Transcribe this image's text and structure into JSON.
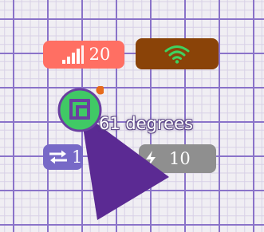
{
  "map": {
    "grid_color": "#8a73c9",
    "background_color": "#f0eef3"
  },
  "signal_badge": {
    "icon": "signal-bars-icon",
    "value": "20",
    "color": "#ff6f63"
  },
  "wifi_badge": {
    "icon": "wifi-icon",
    "color": "#8a4308",
    "icon_color": "#3fd15f"
  },
  "sync_badge": {
    "icon": "sync-arrows-icon",
    "value": "1",
    "color": "#7769c7"
  },
  "charge_badge": {
    "icon": "charging-icon",
    "value": "10",
    "color": "#8f8f8f"
  },
  "vehicle": {
    "icon": "robot-vehicle-icon",
    "ring_color": "#40c965",
    "body_color": "#6a3fa0",
    "status_dot_color": "#e76b1c"
  },
  "heading": {
    "label": "61 degrees",
    "degrees": 61,
    "arrow_color": "#5b2a93"
  }
}
